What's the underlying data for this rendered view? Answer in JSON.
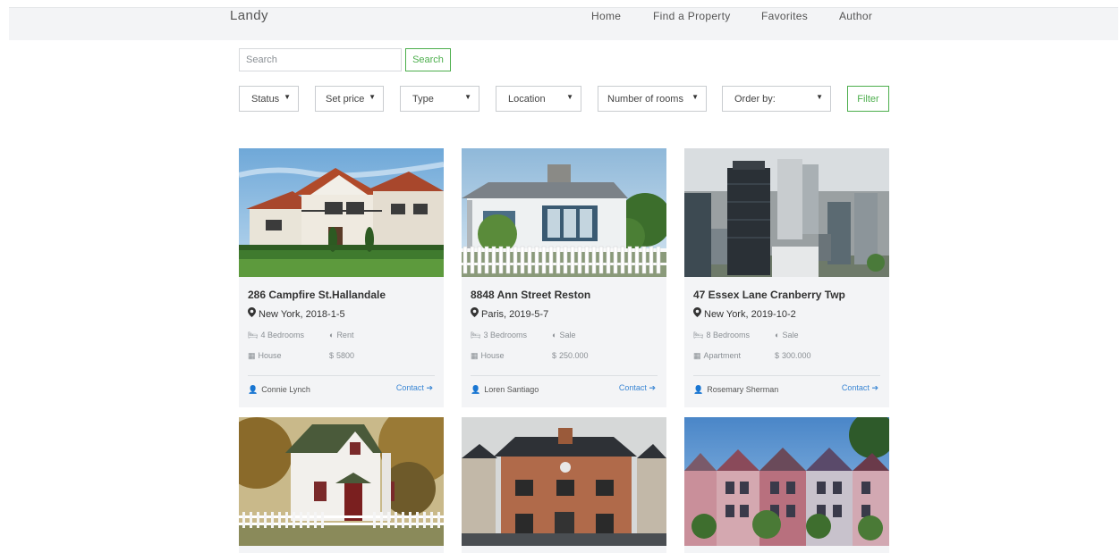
{
  "header": {
    "brand": "Landy",
    "nav": [
      "Home",
      "Find a Property",
      "Favorites",
      "Author"
    ]
  },
  "search": {
    "placeholder": "Search",
    "button": "Search"
  },
  "filters": {
    "status": "Status",
    "price": "Set price",
    "type": "Type",
    "location": "Location",
    "rooms": "Number of rooms",
    "order": "Order by:",
    "filter_button": "Filter"
  },
  "listings": [
    {
      "title": "286 Campfire St.Hallandale",
      "location": "New York, 2018-1-5",
      "bedrooms": "4 Bedrooms",
      "deal": "Rent",
      "type": "House",
      "price": "5800",
      "agent": "Connie Lynch",
      "contact": "Contact"
    },
    {
      "title": "8848 Ann Street Reston",
      "location": "Paris, 2019-5-7",
      "bedrooms": "3 Bedrooms",
      "deal": "Sale",
      "type": "House",
      "price": "250.000",
      "agent": "Loren Santiago",
      "contact": "Contact"
    },
    {
      "title": "47 Essex Lane Cranberry Twp",
      "location": "New York, 2019-10-2",
      "bedrooms": "8 Bedrooms",
      "deal": "Sale",
      "type": "Apartment",
      "price": "300.000",
      "agent": "Rosemary Sherman",
      "contact": "Contact"
    }
  ],
  "colors": {
    "accent_green": "#4cae4c",
    "link_blue": "#3a86d4",
    "card_bg": "#f3f4f6"
  }
}
